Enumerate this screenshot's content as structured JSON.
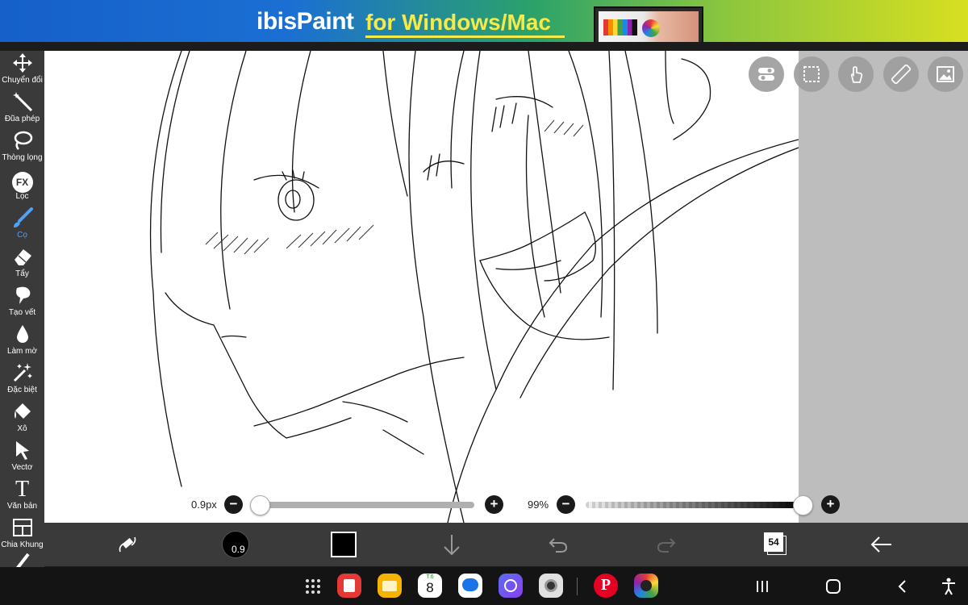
{
  "banner": {
    "brand": "ibisPaint",
    "tagline": "for Windows/Mac"
  },
  "tools": [
    {
      "label": "Chuyển đổi",
      "icon": "move-icon"
    },
    {
      "label": "Đũa phép",
      "icon": "magic-wand-icon"
    },
    {
      "label": "Thòng lọng",
      "icon": "lasso-icon"
    },
    {
      "label": "Lọc",
      "icon": "fx-filter-icon",
      "glyph": "FX"
    },
    {
      "label": "Cọ",
      "icon": "brush-icon",
      "active": true
    },
    {
      "label": "Tẩy",
      "icon": "eraser-icon"
    },
    {
      "label": "Tạo vết",
      "icon": "smudge-icon"
    },
    {
      "label": "Làm mờ",
      "icon": "blur-drop-icon"
    },
    {
      "label": "Đặc biệt",
      "icon": "special-sparkle-icon"
    },
    {
      "label": "Xô",
      "icon": "bucket-icon"
    },
    {
      "label": "Vectơ",
      "icon": "vector-arrow-icon"
    },
    {
      "label": "Văn bản",
      "icon": "text-icon",
      "glyph": "T"
    },
    {
      "label": "Chia Khung",
      "icon": "frame-divider-icon"
    }
  ],
  "top_buttons": [
    "toggle-icon",
    "selection-icon",
    "hand-touch-icon",
    "ruler-icon",
    "image-icon"
  ],
  "brush_size": {
    "value_label": "0.9px",
    "fraction": 0.0
  },
  "opacity": {
    "value_label": "99%",
    "fraction": 0.99
  },
  "bottombar": {
    "brush_preview_label": "0.9",
    "color": "#000000",
    "layer_count": "54",
    "icons": [
      "brush-swap-icon",
      "brush-preview-icon",
      "color-swatch-icon",
      "download-arrow-icon",
      "undo-icon",
      "redo-icon",
      "layers-icon",
      "back-arrow-icon"
    ]
  },
  "navbar": {
    "calendar_day": "8",
    "calendar_weekday": "T.6",
    "apps": [
      "app-drawer-icon",
      "notes-app-icon",
      "files-app-icon",
      "calendar-app-icon",
      "messages-app-icon",
      "internet-app-icon",
      "camera-app-icon",
      "pinterest-app-icon",
      "sketch-app-icon"
    ],
    "nav_icons": [
      "recents-icon",
      "home-icon",
      "back-icon",
      "accessibility-icon"
    ]
  },
  "colors": {
    "toolbar_bg": "#3a3a3a",
    "accent_active": "#4aa3ff",
    "canvas_bg": "#ffffff",
    "workspace_bg": "#bdbdbd",
    "navbar_bg": "#141414"
  }
}
